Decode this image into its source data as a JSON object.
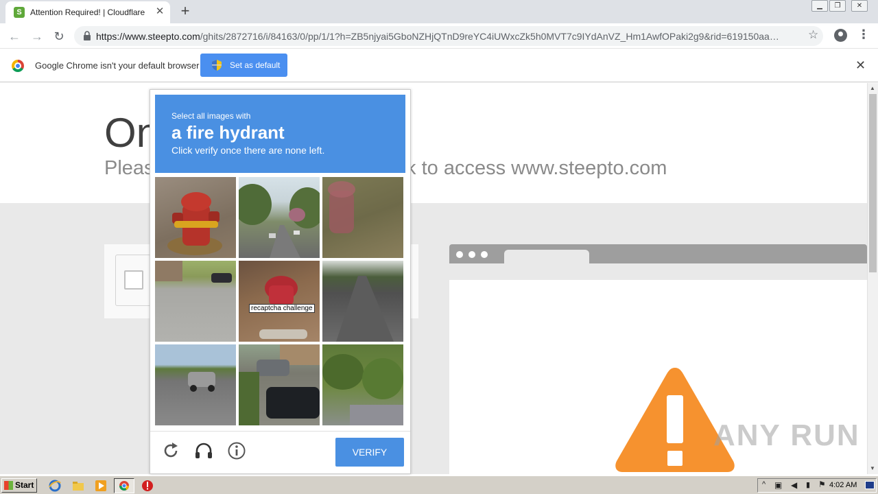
{
  "browser": {
    "tab_title": "Attention Required! | Cloudflare",
    "url_domain": "https://www.steepto.com",
    "url_path": "/ghits/2872716/i/84163/0/pp/1/1?h=ZB5njyai5GboNZHjQTnD9reYC4iUWxcZk5h0MVT7c9IYdAnVZ_Hm1AwfOPaki2g9&rid=619150aa-8d8..."
  },
  "infobar": {
    "message": "Google Chrome isn't your default browser",
    "button_label": "Set as default"
  },
  "page": {
    "heading": "One more step",
    "subheading": "Please complete the security check to access www.steepto.com"
  },
  "captcha": {
    "instruction": "Select all images with",
    "target": "a fire hydrant",
    "hint": "Click verify once there are none left.",
    "tooltip": "recaptcha challenge",
    "verify_label": "VERIFY",
    "tiles": [
      "fire-hydrant",
      "street",
      "fire-hydrant-blurred",
      "road-with-car",
      "fire-hydrant-leaves",
      "empty-road",
      "road-with-suv",
      "parked-cars",
      "shrubs"
    ]
  },
  "watermark": "ANY RUN",
  "taskbar": {
    "start_label": "Start",
    "clock": "4:02 AM"
  },
  "colors": {
    "captcha_blue": "#4a90e2",
    "warning_orange": "#f6922f",
    "infobar_button": "#4a8ff0"
  }
}
